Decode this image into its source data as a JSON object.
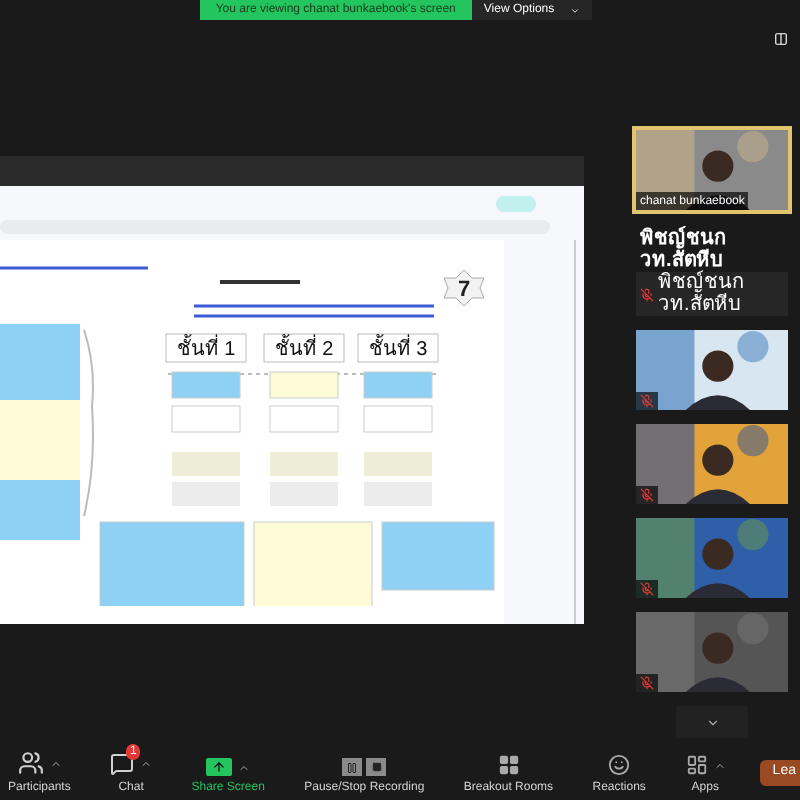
{
  "banner": {
    "text": "You are viewing chanat bunkaebook's screen",
    "button": "View Options"
  },
  "shared_slide": {
    "badge": "7",
    "levels": [
      "ชั้นที่ 1",
      "ชั้นที่ 2",
      "ชั้นที่ 3"
    ]
  },
  "video_tiles": [
    {
      "kind": "video",
      "name": "chanat bunkaebook",
      "active": true,
      "muted": false
    },
    {
      "kind": "name",
      "title": "พิชญ์ชนก วท.สัตหีบ",
      "name": "พิชญ์ชนก วท.สัตหีบ",
      "active": false,
      "muted": true
    },
    {
      "kind": "video",
      "active": false,
      "muted": true
    },
    {
      "kind": "video",
      "active": false,
      "muted": true
    },
    {
      "kind": "video",
      "active": false,
      "muted": true
    },
    {
      "kind": "video",
      "active": false,
      "muted": true
    }
  ],
  "toolbar": [
    {
      "kind": "participants",
      "label": "Participants",
      "has_menu": true
    },
    {
      "kind": "chat",
      "label": "Chat",
      "badge": "1",
      "has_menu": true
    },
    {
      "kind": "share",
      "label": "Share Screen",
      "has_menu": true
    },
    {
      "kind": "recording",
      "label": "Pause/Stop Recording",
      "has_menu": false
    },
    {
      "kind": "breakout",
      "label": "Breakout Rooms",
      "has_menu": false
    },
    {
      "kind": "reactions",
      "label": "Reactions",
      "has_menu": false
    },
    {
      "kind": "apps",
      "label": "Apps",
      "has_menu": true
    }
  ],
  "leave_button": "Lea"
}
